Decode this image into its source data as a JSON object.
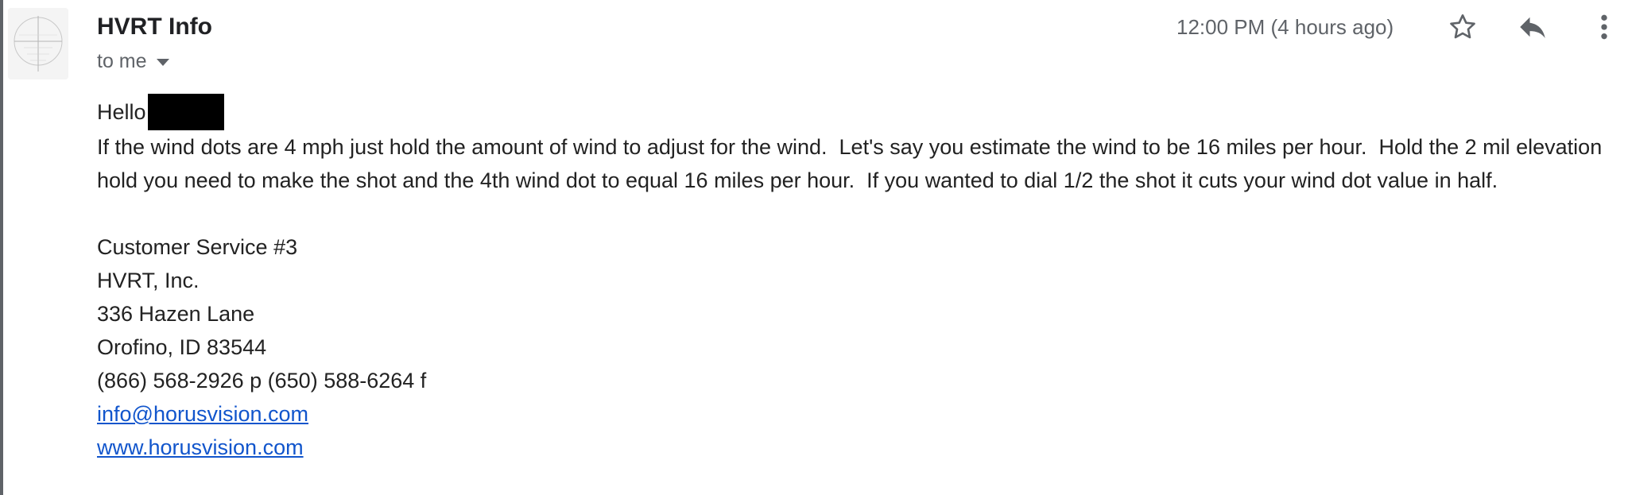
{
  "email": {
    "sender": "HVRT Info",
    "recipient_label": "to me",
    "timestamp": "12:00 PM (4 hours ago)",
    "greeting": "Hello",
    "body_paragraph": "If the wind dots are 4 mph just hold the amount of wind to adjust for the wind.  Let's say you estimate the wind to be 16 miles per hour.  Hold the 2 mil elevation hold you need to make the shot and the 4th wind dot to equal 16 miles per hour.  If you wanted to dial 1/2 the shot it cuts your wind dot value in half.",
    "signature": {
      "line1": "Customer Service #3",
      "line2": "HVRT, Inc.",
      "line3": "336 Hazen Lane",
      "line4": "Orofino, ID 83544",
      "line5": "(866) 568-2926 p (650) 588-6264 f",
      "email_link": "info@horusvision.com",
      "web_link": "www.horusvision.com"
    }
  },
  "icons": {
    "star": "star-icon",
    "reply": "reply-icon",
    "more": "more-vertical-icon",
    "caret": "caret-down-icon"
  },
  "colors": {
    "link": "#1155cc",
    "secondary_text": "#5f6368",
    "primary_text": "#222222"
  }
}
